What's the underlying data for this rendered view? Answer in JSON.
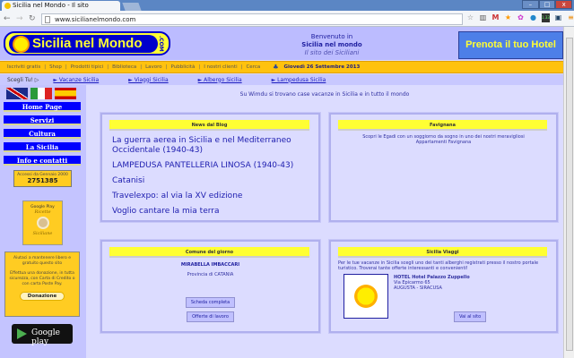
{
  "browser": {
    "tab_title": "Sicilia nel Mondo - Il sito",
    "url": "www.sicilianelmondo.com",
    "window_buttons": [
      "–",
      "□",
      "x"
    ],
    "ext_icons": [
      "☆",
      "▥",
      "M",
      "★",
      "✿",
      "●",
      "1.33",
      "▣",
      "≡"
    ]
  },
  "header": {
    "logo_text": "Sicilia nel Mondo",
    "logo_suffix": ".COM",
    "welcome_line1": "Benvenuto in",
    "welcome_line2": "Sicilia nel mondo",
    "welcome_line3": "Il sito dei Siciliani",
    "hotel_banner": "Prenota il tuo Hotel"
  },
  "topnav": {
    "items": [
      "Iscriviti gratis",
      "Shop",
      "Prodotti tipici",
      "Biblioteca",
      "Lavoro",
      "Pubblicità",
      "I nostri clienti",
      "Cerca"
    ],
    "date": "Giovedì 26 Settembre 2013"
  },
  "subnav": {
    "label": "Scegli Tu! ▷",
    "links": [
      "► Vacanze Sicilia",
      "► Viaggi Sicilia",
      "► Albergo Sicilia",
      "► Lampedusa Sicilia"
    ]
  },
  "sidebar": {
    "menu": [
      "Home Page",
      "Servizi",
      "Cultura",
      "La Sicilia",
      "Info e contatti"
    ],
    "counter_label": "Accessi da Gennaio 2000",
    "counter_value": "2751385",
    "gp_label": "Google Play",
    "gp_title1": "Ricette",
    "gp_title2": "Siciliane",
    "donate_text1": "Aiutaci a mantenere libero e gratuito questo sito",
    "donate_text2": "Effettua una donazione, in tutta sicurezza, con Carta di Credito o con carta Poste Pay.",
    "donate_button": "Donazione",
    "gplay_badge": "Google play"
  },
  "main": {
    "wimdu": "Su Wimdu si trovano case vacanze in Sicilia e in tutto il mondo",
    "news": {
      "title": "News dal Blog",
      "items": [
        "La guerra aerea in Sicilia e nel Mediterraneo Occidentale (1940-43)",
        "LAMPEDUSA PANTELLERIA LINOSA (1940-43)",
        "Catanisi",
        "Travelexpo: al via la XV edizione",
        "Voglio cantare la mia terra"
      ]
    },
    "favignana": {
      "title": "Favignana",
      "text": "Scopri le Egadi con un soggiorno da sogno in uno dei nostri meravigliosi Appartamenti Favignana"
    },
    "comune": {
      "title": "Comune del giorno",
      "name": "MIRABELLA IMBACCARI",
      "province": "Provincia di CATANIA",
      "btn1": "Scheda completa",
      "btn2": "Offerte di lavoro"
    },
    "viaggi": {
      "title": "Sicilia Viaggi",
      "text": "Per le tue vacanze in Sicilia scegli uno dei tanti alberghi registrati presso il nostro portale turistico. Troverai tante offerte interessanti e convenienti!",
      "hotel_name": "HOTEL Hotel Palazzo Zuppello",
      "address1": "Via Epicarmo 65",
      "address2": "AUGUSTA - SIRACUSA",
      "button": "Vai al sito"
    }
  }
}
